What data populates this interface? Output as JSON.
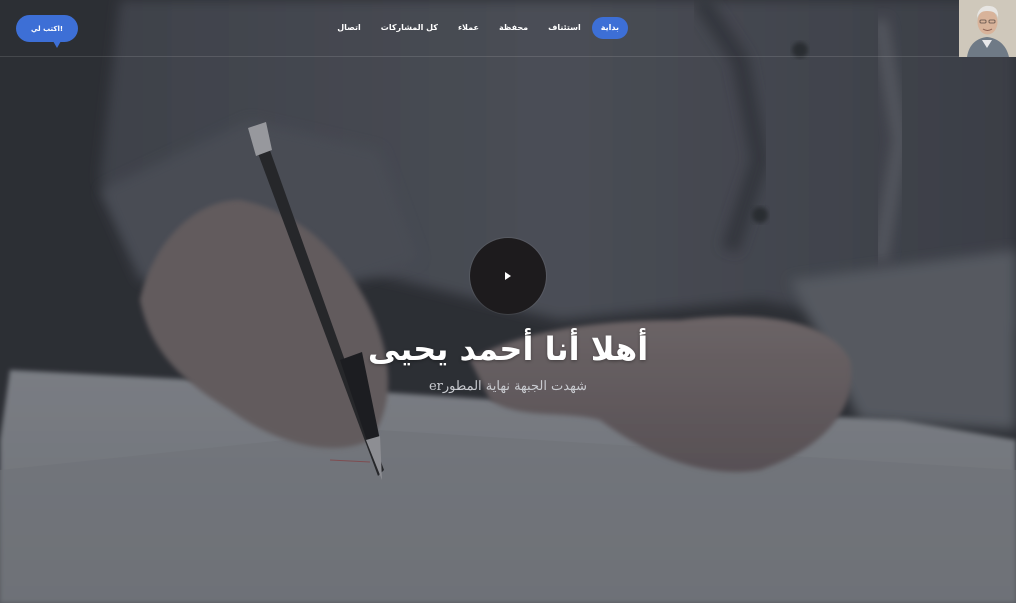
{
  "brand": {
    "accent_color": "#3d6fd6",
    "avatar_icon": "portrait-photo"
  },
  "nav": {
    "items": [
      {
        "label": "بداية",
        "active": true
      },
      {
        "label": "استئناف",
        "active": false
      },
      {
        "label": "محفظة",
        "active": false
      },
      {
        "label": "عملاء",
        "active": false
      },
      {
        "label": "كل المشاركات",
        "active": false
      },
      {
        "label": "اتصال",
        "active": false
      }
    ]
  },
  "contact_button": {
    "label": "اكتب لي!"
  },
  "hero": {
    "play_icon": "play-icon",
    "title": "أهلا أنا  أحمد يحيى",
    "subtitle": "شهدت الجبهة نهاية المطورer"
  }
}
